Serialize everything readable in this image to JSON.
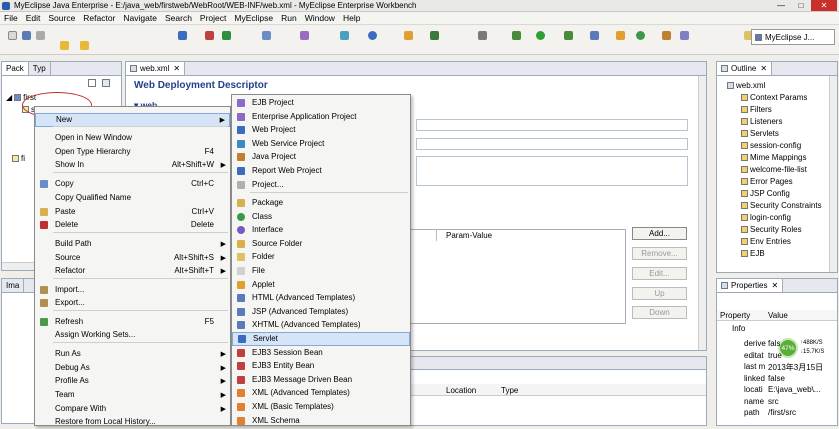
{
  "window": {
    "title": "MyEclipse Java Enterprise - E:/java_web/firstweb/WebRoot/WEB-INF/web.xml - MyEclipse Enterprise Workbench",
    "min": "—",
    "max": "□",
    "close": "✕"
  },
  "menubar": [
    "File",
    "Edit",
    "Source",
    "Refactor",
    "Navigate",
    "Search",
    "Project",
    "MyEclipse",
    "Run",
    "Window",
    "Help"
  ],
  "perspective": "MyEclipse J...",
  "left_tabs": {
    "pack": "Pack",
    "typ": "Typ"
  },
  "tree": {
    "project": "first",
    "src": "src",
    "fi": "fi"
  },
  "bottom_left_tab": "Ima",
  "editor": {
    "tab": "web.xml",
    "heading": "Web Deployment Descriptor",
    "section": "web",
    "col_param_value": "Param-Value"
  },
  "buttons": {
    "add": "Add...",
    "remove": "Remove...",
    "edit": "Edit...",
    "up": "Up",
    "down": "Down"
  },
  "lower_cols": {
    "location": "Location",
    "type": "Type"
  },
  "context_menu": [
    {
      "label": "New",
      "accel": "",
      "arrow": true
    },
    {
      "label": "Open in New Window",
      "accel": "",
      "arrow": false
    },
    {
      "label": "Open Type Hierarchy",
      "accel": "F4",
      "arrow": false
    },
    {
      "label": "Show In",
      "accel": "Alt+Shift+W",
      "arrow": true
    },
    {
      "label": "Copy",
      "accel": "Ctrl+C",
      "arrow": false
    },
    {
      "label": "Copy Qualified Name",
      "accel": "",
      "arrow": false
    },
    {
      "label": "Paste",
      "accel": "Ctrl+V",
      "arrow": false
    },
    {
      "label": "Delete",
      "accel": "Delete",
      "arrow": false
    },
    {
      "label": "Build Path",
      "accel": "",
      "arrow": true
    },
    {
      "label": "Source",
      "accel": "Alt+Shift+S",
      "arrow": true
    },
    {
      "label": "Refactor",
      "accel": "Alt+Shift+T",
      "arrow": true
    },
    {
      "label": "Import...",
      "accel": "",
      "arrow": false
    },
    {
      "label": "Export...",
      "accel": "",
      "arrow": false
    },
    {
      "label": "Refresh",
      "accel": "F5",
      "arrow": false
    },
    {
      "label": "Assign Working Sets...",
      "accel": "",
      "arrow": false
    },
    {
      "label": "Run As",
      "accel": "",
      "arrow": true
    },
    {
      "label": "Debug As",
      "accel": "",
      "arrow": true
    },
    {
      "label": "Profile As",
      "accel": "",
      "arrow": true
    },
    {
      "label": "Team",
      "accel": "",
      "arrow": true
    },
    {
      "label": "Compare With",
      "accel": "",
      "arrow": true
    },
    {
      "label": "Restore from Local History...",
      "accel": "",
      "arrow": false
    }
  ],
  "submenu": [
    "EJB Project",
    "Enterprise Application Project",
    "Web Project",
    "Web Service Project",
    "Java Project",
    "Report Web Project",
    "Project...",
    "Package",
    "Class",
    "Interface",
    "Source Folder",
    "Folder",
    "File",
    "Applet",
    "HTML (Advanced Templates)",
    "JSP (Advanced Templates)",
    "XHTML (Advanced Templates)",
    "Servlet",
    "EJB3 Session Bean",
    "EJB3 Entity Bean",
    "EJB3 Message Driven Bean",
    "XML (Advanced Templates)",
    "XML (Basic Templates)",
    "XML Schema"
  ],
  "outline": {
    "tab": "Outline",
    "root": "web.xml",
    "items": [
      "Context Params",
      "Filters",
      "Listeners",
      "Servlets",
      "session-config",
      "Mime Mappings",
      "welcome-file-list",
      "Error Pages",
      "JSP Config",
      "Security Constraints",
      "login-config",
      "Security Roles",
      "Env Entries",
      "EJB"
    ]
  },
  "properties": {
    "tab": "Properties",
    "col_property": "Property",
    "col_value": "Value",
    "group": "Info",
    "rows": [
      [
        "derive",
        "fals"
      ],
      [
        "editat",
        "true"
      ],
      [
        "last m",
        "2013年3月15日"
      ],
      [
        "linked",
        "false"
      ],
      [
        "locati",
        "E:\\java_web\\..."
      ],
      [
        "name",
        "src"
      ],
      [
        "path",
        "/first/src"
      ]
    ]
  },
  "netmeter": {
    "pct": "47%",
    "up": "488K/S",
    "down": "15.7K/S"
  },
  "colors": {
    "accent": "#23408c",
    "highlight": "#d6e4f7",
    "circle": "#c0302a"
  }
}
